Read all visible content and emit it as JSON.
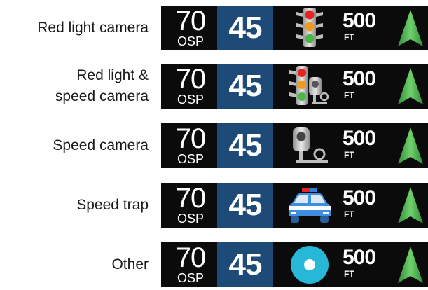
{
  "alerts": [
    {
      "label_lines": [
        "Red light camera"
      ],
      "icon": "traffic-light-icon",
      "osp": "70",
      "osp_label": "OSP",
      "limit": "45",
      "distance": "500",
      "distance_unit": "FT"
    },
    {
      "label_lines": [
        "Red light &",
        "speed camera"
      ],
      "icon": "traffic-light-speed-camera-icon",
      "osp": "70",
      "osp_label": "OSP",
      "limit": "45",
      "distance": "500",
      "distance_unit": "FT"
    },
    {
      "label_lines": [
        "Speed camera"
      ],
      "icon": "speed-camera-icon",
      "osp": "70",
      "osp_label": "OSP",
      "limit": "45",
      "distance": "500",
      "distance_unit": "FT"
    },
    {
      "label_lines": [
        "Speed trap"
      ],
      "icon": "police-car-icon",
      "osp": "70",
      "osp_label": "OSP",
      "limit": "45",
      "distance": "500",
      "distance_unit": "FT"
    },
    {
      "label_lines": [
        "Other"
      ],
      "icon": "generic-alert-icon",
      "osp": "70",
      "osp_label": "OSP",
      "limit": "45",
      "distance": "500",
      "distance_unit": "FT"
    }
  ],
  "colors": {
    "strip_background": "#0b0b0b",
    "limit_box": "#1e4a78",
    "arrow": "#3fb24a",
    "light_red": "#e52421",
    "light_amber": "#f39a1e",
    "light_green": "#4cb748",
    "police_blue": "#2f7fd6",
    "other_dot": "#27b8d8"
  }
}
